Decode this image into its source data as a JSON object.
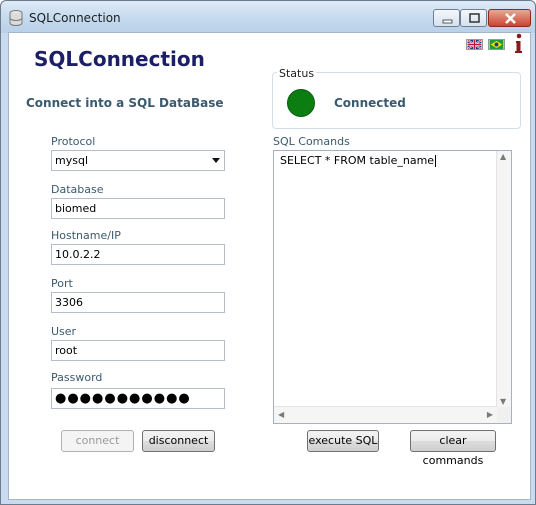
{
  "window": {
    "title": "SQLConnection",
    "icon": "database-icon",
    "controls": [
      "minimize-icon",
      "maximize-icon",
      "close-icon"
    ]
  },
  "header": {
    "app_title": "SQLConnection",
    "subtitle": "Connect into a SQL DataBase",
    "languages": [
      "uk-flag-icon",
      "brazil-flag-icon"
    ],
    "info_icon": "info-icon"
  },
  "status": {
    "legend": "Status",
    "text": "Connected",
    "color": "#0b7d11"
  },
  "form": {
    "protocol": {
      "label": "Protocol",
      "value": "mysql"
    },
    "database": {
      "label": "Database",
      "value": "biomed"
    },
    "hostname": {
      "label": "Hostname/IP",
      "value": "10.0.2.2"
    },
    "port": {
      "label": "Port",
      "value": "3306"
    },
    "user": {
      "label": "User",
      "value": "root"
    },
    "password": {
      "label": "Password",
      "value": "●●●●●●●●●●●"
    }
  },
  "buttons": {
    "connect": "connect",
    "disconnect": "disconnect",
    "execute": "execute SQL",
    "clear": "clear commands"
  },
  "sql": {
    "label": "SQL Comands",
    "text": "SELECT * FROM table_name"
  },
  "colors": {
    "title": "#1c1f66",
    "label": "#3b5a6e",
    "status_on": "#0b7d11"
  }
}
